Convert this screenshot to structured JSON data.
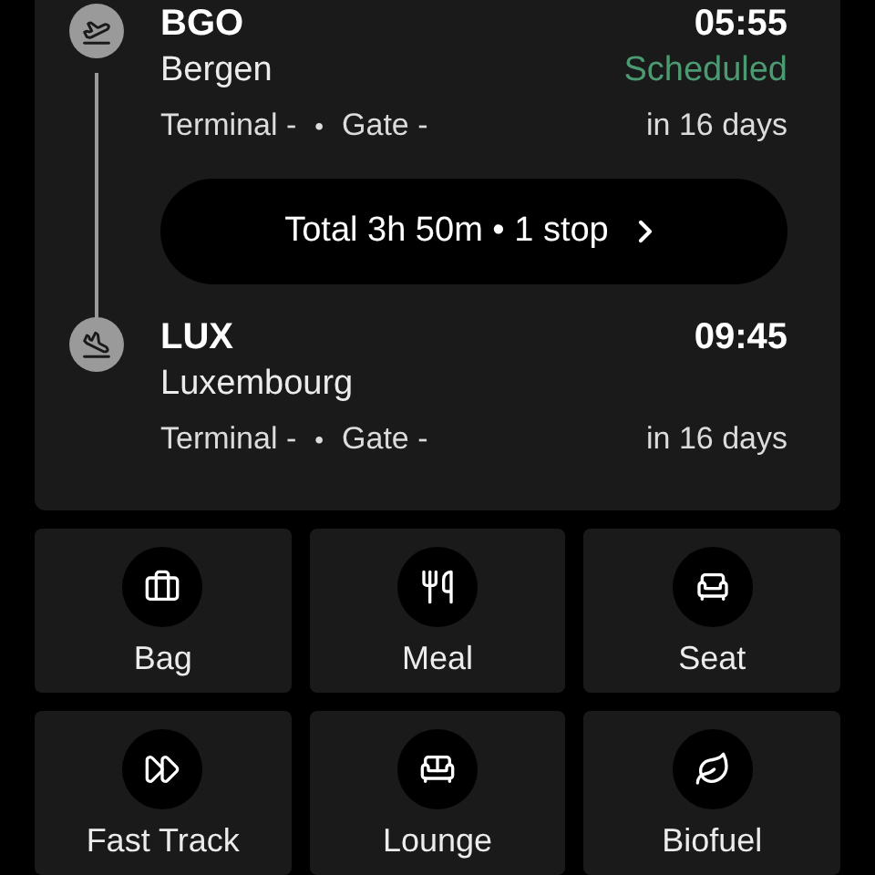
{
  "stops": [
    {
      "kind": "departure",
      "code": "BGO",
      "time": "05:55",
      "city": "Bergen",
      "status": "Scheduled",
      "terminal": "Terminal -",
      "separator": "•",
      "gate": "Gate -",
      "relative": "in 16 days"
    },
    {
      "kind": "arrival",
      "code": "LUX",
      "time": "09:45",
      "city": "Luxembourg",
      "terminal": "Terminal -",
      "separator": "•",
      "gate": "Gate -",
      "relative": "in 16 days"
    }
  ],
  "summary": "Total 3h 50m • 1 stop",
  "services": [
    {
      "kind": "bag",
      "label": "Bag"
    },
    {
      "kind": "meal",
      "label": "Meal"
    },
    {
      "kind": "seat",
      "label": "Seat"
    },
    {
      "kind": "fasttrack",
      "label": "Fast Track"
    },
    {
      "kind": "lounge",
      "label": "Lounge"
    },
    {
      "kind": "biofuel",
      "label": "Biofuel"
    }
  ]
}
